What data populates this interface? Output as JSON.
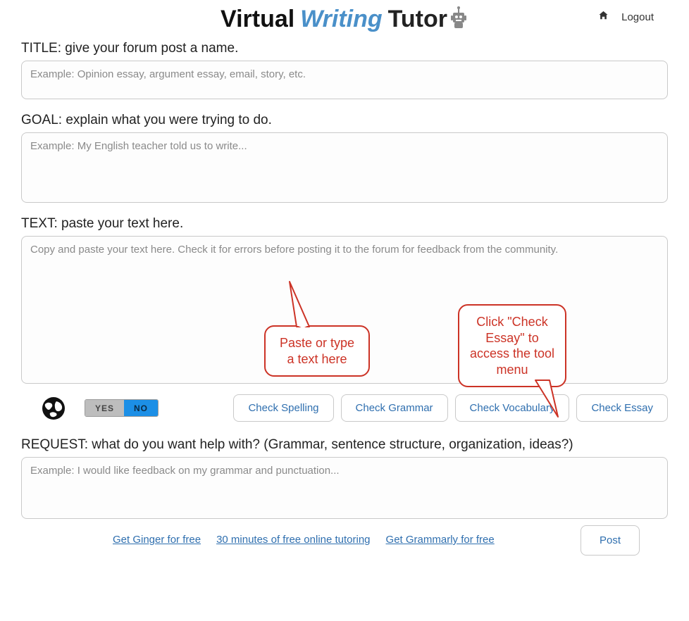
{
  "nav": {
    "home_icon": "home-icon",
    "logout_label": "Logout"
  },
  "logo": {
    "word1": "Virtual",
    "word2": "Writing",
    "word3": "Tutor"
  },
  "fields": {
    "title": {
      "label": "TITLE: give your forum post a name.",
      "placeholder": "Example: Opinion essay, argument essay, email, story, etc."
    },
    "goal": {
      "label": "GOAL: explain what you were trying to do.",
      "placeholder": "Example: My English teacher told us to write..."
    },
    "text": {
      "label": "TEXT: paste your text here.",
      "placeholder": "Copy and paste your text here. Check it for errors before posting it to the forum for feedback from the community."
    },
    "request": {
      "label": "REQUEST: what do you want help with? (Grammar, sentence structure, organization, ideas?)",
      "placeholder": "Example: I would like feedback on my grammar and punctuation..."
    }
  },
  "toggle": {
    "yes": "YES",
    "no": "NO"
  },
  "buttons": {
    "check_spelling": "Check Spelling",
    "check_grammar": "Check Grammar",
    "check_vocabulary": "Check Vocabulary",
    "check_essay": "Check Essay",
    "post": "Post"
  },
  "footer_links": {
    "ginger": "Get Ginger for free",
    "tutoring": "30 minutes of free online tutoring",
    "grammarly": "Get Grammarly for free"
  },
  "callouts": {
    "paste": "Paste or type a text here",
    "check": "Click \"Check Essay\" to access the tool menu"
  }
}
